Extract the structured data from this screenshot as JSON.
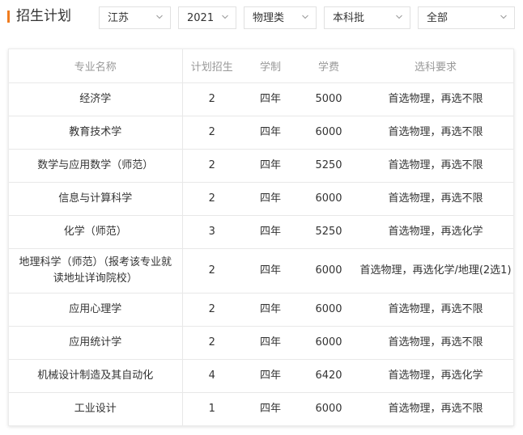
{
  "page_title": "招生计划",
  "colors": {
    "accent": "#f07c1e",
    "border": "#e1e1e1",
    "header_text": "#999999"
  },
  "filters": {
    "province": "江苏",
    "year": "2021",
    "subject": "物理类",
    "batch": "本科批",
    "scope": "全部"
  },
  "table": {
    "headers": [
      "专业名称",
      "计划招生",
      "学制",
      "学费",
      "选科要求"
    ],
    "rows": [
      [
        "经济学",
        "2",
        "四年",
        "5000",
        "首选物理，再选不限"
      ],
      [
        "教育技术学",
        "2",
        "四年",
        "6000",
        "首选物理，再选不限"
      ],
      [
        "数学与应用数学（师范）",
        "2",
        "四年",
        "5250",
        "首选物理，再选不限"
      ],
      [
        "信息与计算科学",
        "2",
        "四年",
        "6000",
        "首选物理，再选不限"
      ],
      [
        "化学（师范）",
        "3",
        "四年",
        "5250",
        "首选物理，再选化学"
      ],
      [
        "地理科学（师范）（报考该专业就读地址详询院校）",
        "2",
        "四年",
        "6000",
        "首选物理，再选化学/地理(2选1)"
      ],
      [
        "应用心理学",
        "2",
        "四年",
        "6000",
        "首选物理，再选不限"
      ],
      [
        "应用统计学",
        "2",
        "四年",
        "6000",
        "首选物理，再选不限"
      ],
      [
        "机械设计制造及其自动化",
        "4",
        "四年",
        "6420",
        "首选物理，再选化学"
      ],
      [
        "工业设计",
        "1",
        "四年",
        "6000",
        "首选物理，再选不限"
      ]
    ]
  }
}
